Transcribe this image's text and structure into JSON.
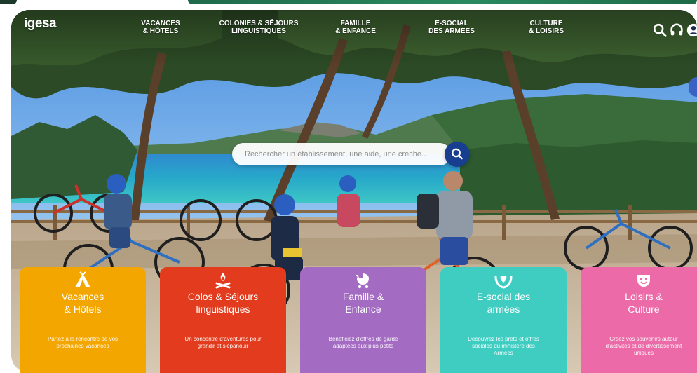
{
  "brand": {
    "logo_text": "igesa"
  },
  "nav": {
    "items": [
      {
        "line1": "VACANCES",
        "line2": "& HÔTELS"
      },
      {
        "line1": "COLONIES & SÉJOURS",
        "line2": "LINGUISTIQUES"
      },
      {
        "line1": "FAMILLE",
        "line2": "& ENFANCE"
      },
      {
        "line1": "E-SOCIAL",
        "line2": "DES ARMÉES"
      },
      {
        "line1": "CULTURE",
        "line2": "& LOISIRS"
      }
    ]
  },
  "header_icons": [
    "search-icon",
    "headset-icon",
    "user-icon"
  ],
  "search": {
    "placeholder": "Rechercher un établissement, une aide, une crèche..."
  },
  "cards": [
    {
      "icon": "tent-icon",
      "color": "#f3a500",
      "title1": "Vacances",
      "title2": "& Hôtels",
      "desc": [
        "Partez à la rencontre de vos",
        "prochaines vacances"
      ]
    },
    {
      "icon": "campfire-icon",
      "color": "#e23b1d",
      "title1": "Colos & Séjours",
      "title2": "linguistiques",
      "desc": [
        "Un concentré d'aventures pour",
        "grandir et s'épanouir"
      ]
    },
    {
      "icon": "stroller-icon",
      "color": "#a46bc2",
      "title1": "Famille &",
      "title2": "Enfance",
      "desc": [
        "Bénéficiez d'offres de garde",
        "adaptées aux plus petits"
      ]
    },
    {
      "icon": "heart-hands-icon",
      "color": "#3fcdc2",
      "title1": "E-social des",
      "title2": "armées",
      "desc": [
        "Découvrez les prêts et offres",
        "sociales du ministère des",
        "Armées"
      ]
    },
    {
      "icon": "theater-masks-icon",
      "color": "#ec6aa8",
      "title1": "Loisirs &",
      "title2": "Culture",
      "desc": [
        "Créez vos souvenirs autour",
        "d'activités et de divertissement",
        "uniques"
      ]
    }
  ]
}
